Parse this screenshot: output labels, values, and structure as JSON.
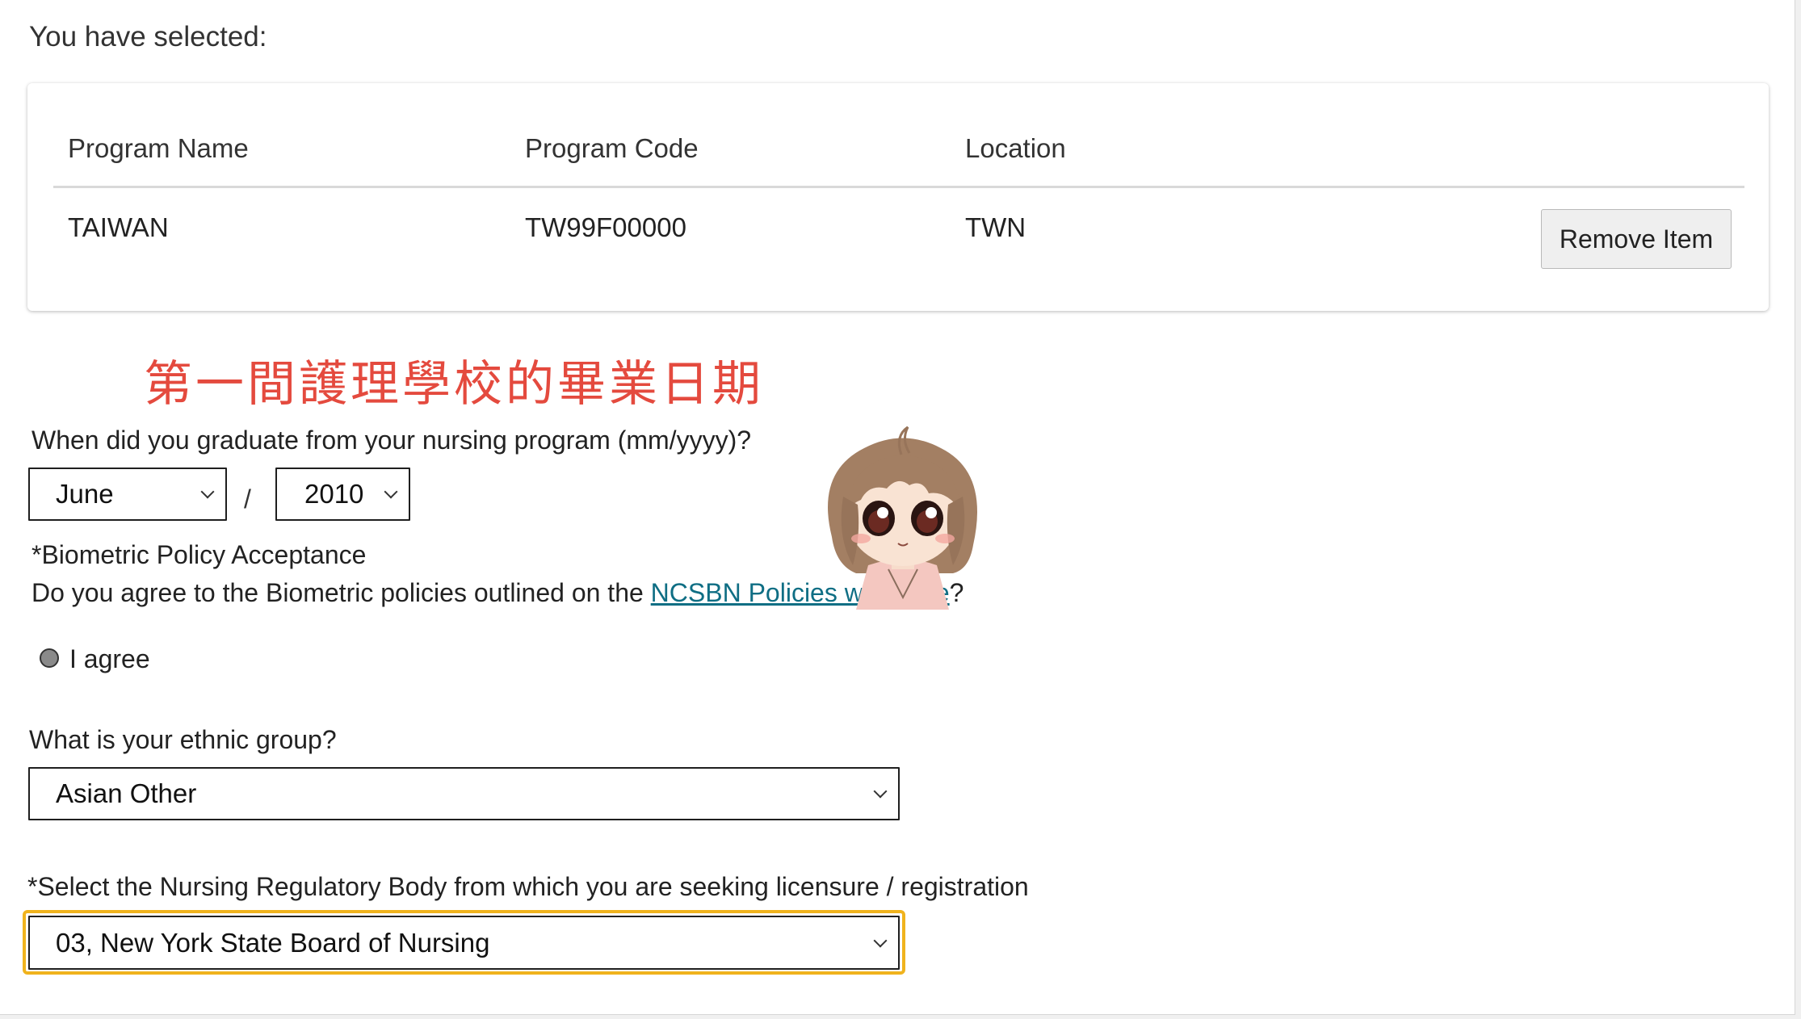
{
  "selection": {
    "heading": "You have selected:",
    "columns": [
      "Program Name",
      "Program Code",
      "Location"
    ],
    "row": {
      "name": "TAIWAN",
      "code": "TW99F00000",
      "location": "TWN"
    },
    "remove_label": "Remove Item"
  },
  "annotation": "第一間護理學校的畢業日期",
  "graduation": {
    "question": "When did you graduate from your nursing program (mm/yyyy)?",
    "month": "June",
    "separator": "/",
    "year": "2010"
  },
  "biometric": {
    "title": "*Biometric Policy Acceptance",
    "question_prefix": "Do you agree to the Biometric policies outlined on the ",
    "link_text": "NCSBN Policies webpage",
    "question_suffix": "?",
    "agree_label": "I agree"
  },
  "ethnic": {
    "question": "What is your ethnic group?",
    "value": "Asian Other"
  },
  "regulatory": {
    "question": "*Select the Nursing Regulatory Body from which you are seeking licensure / registration",
    "value": "03, New York State Board of Nursing"
  },
  "colors": {
    "annotation": "#e44a3e",
    "link": "#0f6e84",
    "focus": "#f0b31d"
  },
  "icons": [
    "chevron-down-icon",
    "radio-icon",
    "mascot-icon"
  ]
}
